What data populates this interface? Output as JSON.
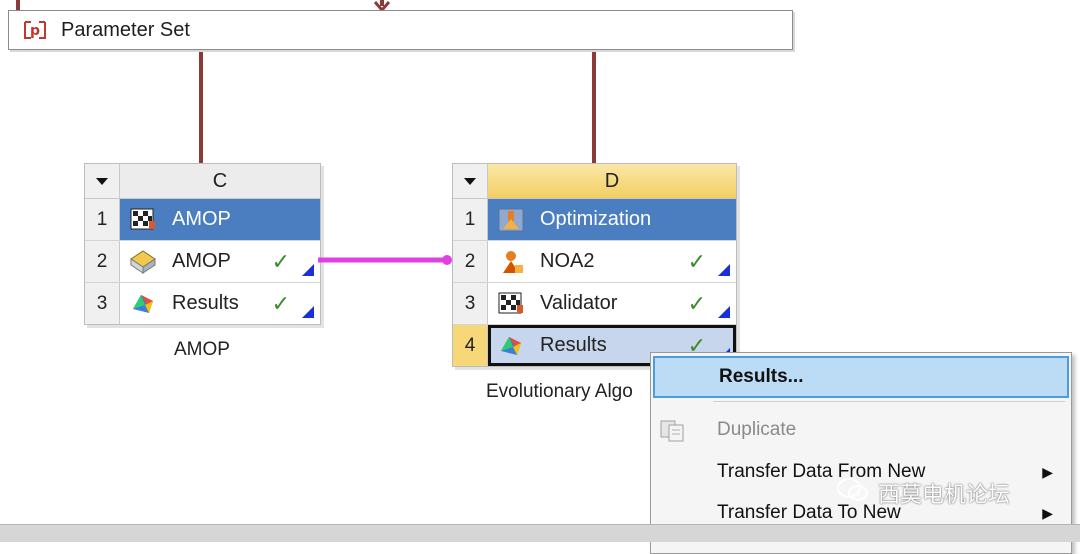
{
  "parameter_set": {
    "label": "Parameter Set",
    "icon": "parameter-set-icon"
  },
  "systems": [
    {
      "column": "C",
      "caption": "AMOP",
      "rows": [
        {
          "num": "1",
          "label": "AMOP",
          "icon": "amop-flag-icon",
          "check": ""
        },
        {
          "num": "2",
          "label": "AMOP",
          "icon": "amop-cell-icon",
          "check": "✓"
        },
        {
          "num": "3",
          "label": "Results",
          "icon": "results-icon",
          "check": "✓"
        }
      ]
    },
    {
      "column": "D",
      "caption": "Evolutionary Algo",
      "rows": [
        {
          "num": "1",
          "label": "Optimization",
          "icon": "optimization-icon",
          "check": ""
        },
        {
          "num": "2",
          "label": "NOA2",
          "icon": "noa2-icon",
          "check": "✓"
        },
        {
          "num": "3",
          "label": "Validator",
          "icon": "validator-icon",
          "check": "✓"
        },
        {
          "num": "4",
          "label": "Results",
          "icon": "results-icon",
          "check": "✓"
        }
      ]
    }
  ],
  "context_menu": {
    "items": [
      {
        "label": "Results...",
        "state": "highlighted"
      },
      {
        "label": "Duplicate",
        "state": "disabled",
        "icon": "duplicate-icon"
      },
      {
        "label": "Transfer Data From New",
        "state": "normal",
        "submenu": "▶"
      },
      {
        "label": "Transfer Data To New",
        "state": "normal",
        "submenu": "▶"
      }
    ]
  },
  "watermark": {
    "text": "西莫电机论坛",
    "icon": "wechat-icon"
  },
  "colors": {
    "connector": "#8b3a3a",
    "link": "#e040e0",
    "header_blue": "#4a7ec0",
    "active_header": "#f3cf62",
    "check": "#3d8a2a",
    "menu_highlight": "#bcdcf6"
  }
}
